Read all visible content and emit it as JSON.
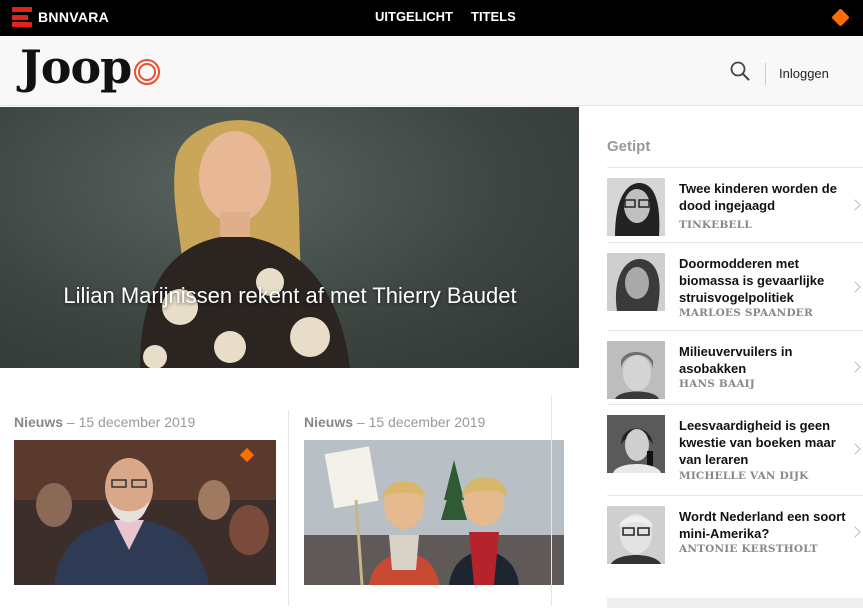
{
  "topbar": {
    "brand": "BNNVARA",
    "nav": [
      "UITGELICHT",
      "TITELS"
    ]
  },
  "header": {
    "logo": "Joop",
    "login": "Inloggen"
  },
  "hero": {
    "title": "Lilian Marijnissen rekent af met Thierry Baudet"
  },
  "articles": [
    {
      "category": "Nieuws",
      "separator": "–",
      "date": "15 december 2019"
    },
    {
      "category": "Nieuws",
      "separator": "–",
      "date": "15 december 2019"
    }
  ],
  "sidebar": {
    "title": "Getipt",
    "items": [
      {
        "title": "Twee kinderen worden de dood ingejaagd",
        "author": "TINKEBELL"
      },
      {
        "title": "Doormodderen met biomassa is gevaarlijke struisvogelpolitiek",
        "author": "MARLOES SPAANDER"
      },
      {
        "title": "Milieuvervuilers in asobakken",
        "author": "HANS BAAIJ"
      },
      {
        "title": "Leesvaardigheid is geen kwestie van boeken maar van leraren",
        "author": "MICHELLE VAN DIJK"
      },
      {
        "title": "Wordt Nederland een soort mini-Amerika?",
        "author": "ANTONIE KERSTHOLT"
      }
    ]
  },
  "colors": {
    "brand_red": "#e2231a",
    "joop_orange": "#e8502f",
    "npo_orange": "#ff6d00"
  }
}
